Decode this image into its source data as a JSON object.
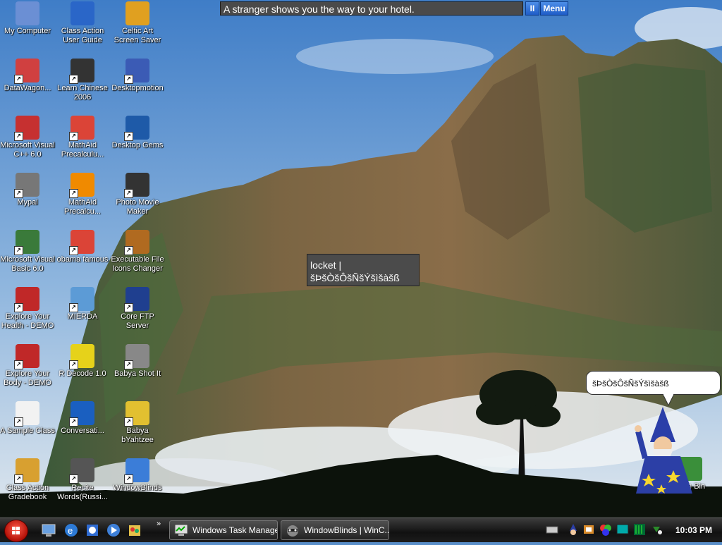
{
  "top_bar": {
    "message": "A stranger shows you the way to your hotel.",
    "pause_label": "II",
    "menu_label": "Menu"
  },
  "word_popup": {
    "line1": "locket  |",
    "line2": "šÞšÒšÔšÑšÝšìšàšß"
  },
  "speech_bubble": {
    "text": "šÞšÒšÔšÑšÝšìšàšß"
  },
  "desktop_icons": [
    {
      "label": "My Computer",
      "icon": "computer-icon"
    },
    {
      "label": "Class Action User Guide",
      "icon": "help-icon"
    },
    {
      "label": "Celtic Art Screen Saver",
      "icon": "windows-flag-icon"
    },
    {
      "label": "DataWagon...",
      "icon": "datawagon-icon"
    },
    {
      "label": "Learn Chinese 2006",
      "icon": "chinese-char-icon"
    },
    {
      "label": "Desktopmotion",
      "icon": "desktopmotion-icon"
    },
    {
      "label": "Microsoft Visual C++ 6.0",
      "icon": "visual-cpp-icon"
    },
    {
      "label": "MathAid Precalculu...",
      "icon": "chrome-icon"
    },
    {
      "label": "Desktop Gems",
      "icon": "monitor-icon"
    },
    {
      "label": "Mypal",
      "icon": "raccoon-icon"
    },
    {
      "label": "MathAid Precalcu...",
      "icon": "mathaid-icon"
    },
    {
      "label": "Photo Movie Maker",
      "icon": "clapperboard-icon"
    },
    {
      "label": "Microsoft Visual Basic 6.0",
      "icon": "visual-basic-icon"
    },
    {
      "label": "obama famous",
      "icon": "chrome-icon"
    },
    {
      "label": "Executable File Icons Changer",
      "icon": "icon-changer-icon"
    },
    {
      "label": "Explore Your Health - DEMO",
      "icon": "explore-health-icon"
    },
    {
      "label": "MIERDA",
      "icon": "document-icon"
    },
    {
      "label": "Core FTP Server",
      "icon": "ftp-icon"
    },
    {
      "label": "Explore Your Body - DEMO",
      "icon": "explore-body-icon"
    },
    {
      "label": "R Decode 1.0",
      "icon": "rdecode-icon"
    },
    {
      "label": "Babya Shot It",
      "icon": "camera-icon"
    },
    {
      "label": "A Sample Class",
      "icon": "document-pen-icon"
    },
    {
      "label": "Conversati...",
      "icon": "conversation-icon"
    },
    {
      "label": "Babya bYahtzee",
      "icon": "dice-icon"
    },
    {
      "label": "Class Action Gradebook",
      "icon": "gradebook-icon"
    },
    {
      "label": "Recite Words(Russi...",
      "icon": "recite-icon"
    },
    {
      "label": "WindowBlinds",
      "icon": "windowblinds-icon"
    }
  ],
  "recycle_bin": {
    "label": "...cle Bin",
    "icon": "recycle-bin-icon"
  },
  "taskbar": {
    "quick_launch_more": "»",
    "tasks": [
      {
        "label": "Windows Task Manager",
        "icon": "task-manager-icon"
      },
      {
        "label": "WindowBlinds | WinC...",
        "icon": "raccoon-icon"
      }
    ],
    "clock": "10:03 PM"
  },
  "colors": {
    "sky": "#5a8fc9",
    "cliff": "#7a6a45",
    "taskbar": "#1c1c1c",
    "accent_blue": "#1f5dc7"
  }
}
